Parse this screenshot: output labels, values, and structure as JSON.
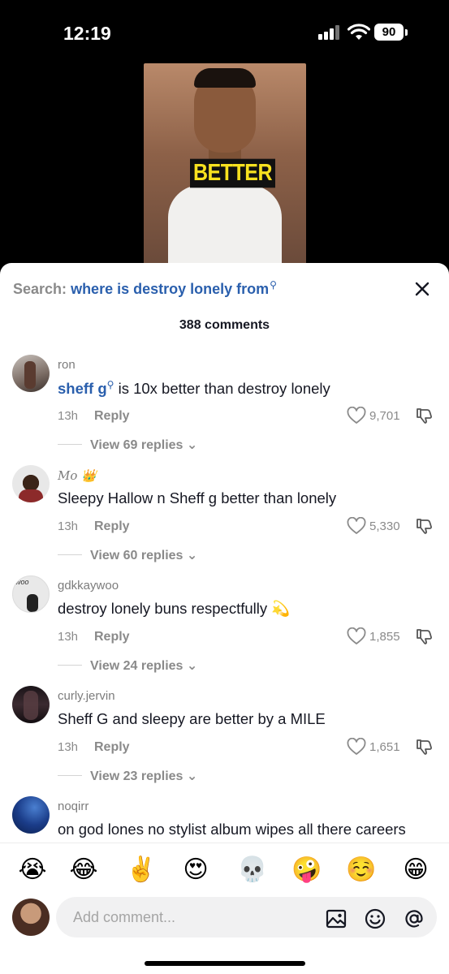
{
  "status_bar": {
    "time": "12:19",
    "battery": "90"
  },
  "video": {
    "caption": "BETTER"
  },
  "header": {
    "search_label": "Search:",
    "search_query": "where is destroy lonely from",
    "comment_count": "388 comments"
  },
  "comments": [
    {
      "username": "ron",
      "text_link": "sheff g",
      "text": " is 10x better than destroy lonely",
      "age": "13h",
      "reply": "Reply",
      "likes": "9,701",
      "view_replies": "View 69 replies"
    },
    {
      "username": "Mo 👑",
      "text": "Sleepy Hallow n Sheff g better than lonely",
      "age": "13h",
      "reply": "Reply",
      "likes": "5,330",
      "view_replies": "View 60 replies"
    },
    {
      "username": "gdkkaywoo",
      "text": "destroy lonely buns respectfully 💫",
      "age": "13h",
      "reply": "Reply",
      "likes": "1,855",
      "view_replies": "View 24 replies"
    },
    {
      "username": "curly.jervin",
      "text": "Sheff G and sleepy are better by a MILE",
      "age": "13h",
      "reply": "Reply",
      "likes": "1,651",
      "view_replies": "View 23 replies"
    },
    {
      "username": "noqirr",
      "text": "on god lones no stylist album wipes all there careers"
    }
  ],
  "emoji_bar": [
    "😭",
    "😂",
    "✌️",
    "😍",
    "💀",
    "🤪",
    "☺️",
    "😁"
  ],
  "composer": {
    "placeholder": "Add comment..."
  },
  "icons": {
    "close": "close-icon",
    "heart": "heart-icon",
    "dislike": "thumbs-down-icon",
    "image": "image-icon",
    "emoji": "smiley-icon",
    "mention": "at-sign-icon",
    "search": "search-icon"
  },
  "colors": {
    "link": "#2a5fad",
    "muted": "#8a8a8a",
    "text": "#161823"
  }
}
